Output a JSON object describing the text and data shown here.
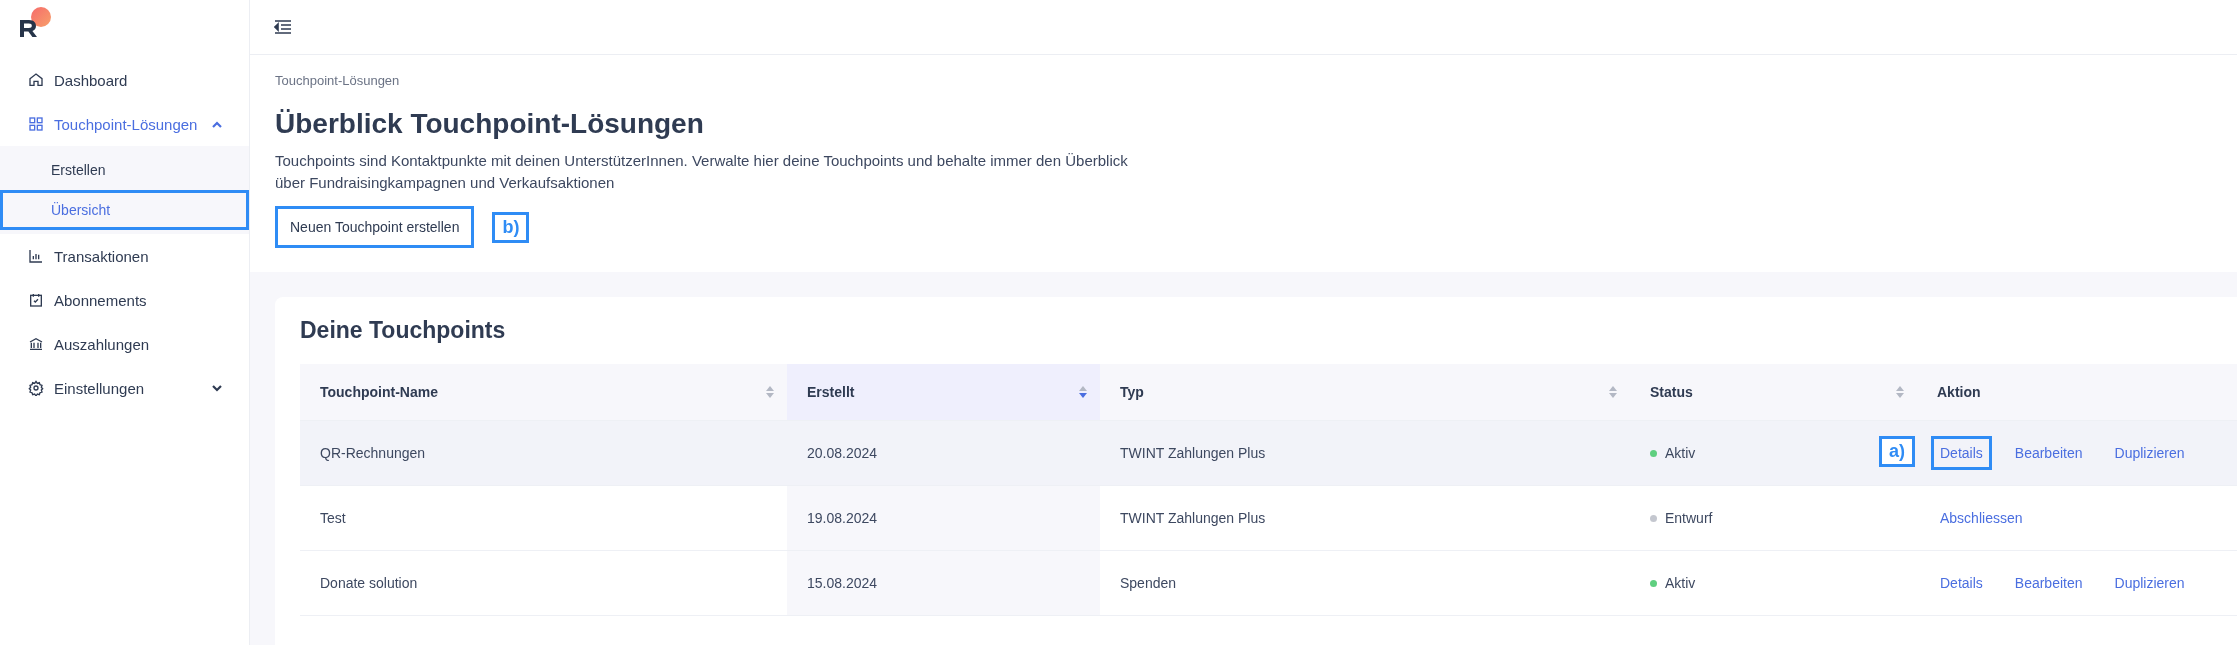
{
  "sidebar": {
    "items": [
      {
        "label": "Dashboard",
        "selected": false
      },
      {
        "label": "Touchpoint-Lösungen",
        "selected": true,
        "expanded": true,
        "children": [
          {
            "label": "Erstellen",
            "selected": false,
            "highlighted": false
          },
          {
            "label": "Übersicht",
            "selected": true,
            "highlighted": true
          }
        ]
      },
      {
        "label": "Transaktionen",
        "selected": false
      },
      {
        "label": "Abonnements",
        "selected": false
      },
      {
        "label": "Auszahlungen",
        "selected": false
      },
      {
        "label": "Einstellungen",
        "selected": false,
        "expanded": false
      }
    ]
  },
  "breadcrumb": "Touchpoint-Lösungen",
  "title": "Überblick Touchpoint-Lösungen",
  "description": "Touchpoints sind Kontaktpunkte mit deinen UnterstützerInnen. Verwalte hier deine Touchpoints und behalte immer den Überblick über Fundraisingkampagnen und Verkaufsaktionen",
  "create_button": {
    "label": "Neuen Touchpoint erstellen",
    "highlighted": true,
    "annotation": "b)"
  },
  "card": {
    "title": "Deine Touchpoints",
    "table": {
      "columns": [
        {
          "label": "Touchpoint-Name",
          "sortable": true,
          "sorted": false
        },
        {
          "label": "Erstellt",
          "sortable": true,
          "sorted": true
        },
        {
          "label": "Typ",
          "sortable": true,
          "sorted": false
        },
        {
          "label": "Status",
          "sortable": true,
          "sorted": false
        },
        {
          "label": "Aktion",
          "sortable": false
        }
      ],
      "rows": [
        {
          "name": "QR-Rechnungen",
          "created": "20.08.2024",
          "type": "TWINT Zahlungen Plus",
          "status": "Aktiv",
          "color": "#5fcf80",
          "hovered": true,
          "actions": [
            {
              "label": "Details",
              "highlighted": true,
              "annotation": "a)"
            },
            {
              "label": "Bearbeiten",
              "highlighted": false
            },
            {
              "label": "Duplizieren",
              "highlighted": false
            }
          ]
        },
        {
          "name": "Test",
          "created": "19.08.2024",
          "type": "TWINT Zahlungen Plus",
          "status": "Entwurf",
          "color": "#c4c7cf",
          "hovered": false,
          "actions": [
            {
              "label": "Abschliessen",
              "highlighted": false
            }
          ]
        },
        {
          "name": "Donate solution",
          "created": "15.08.2024",
          "type": "Spenden",
          "status": "Aktiv",
          "color": "#5fcf80",
          "hovered": false,
          "actions": [
            {
              "label": "Details",
              "highlighted": false
            },
            {
              "label": "Bearbeiten",
              "highlighted": false
            },
            {
              "label": "Duplizieren",
              "highlighted": false
            }
          ]
        }
      ]
    }
  }
}
